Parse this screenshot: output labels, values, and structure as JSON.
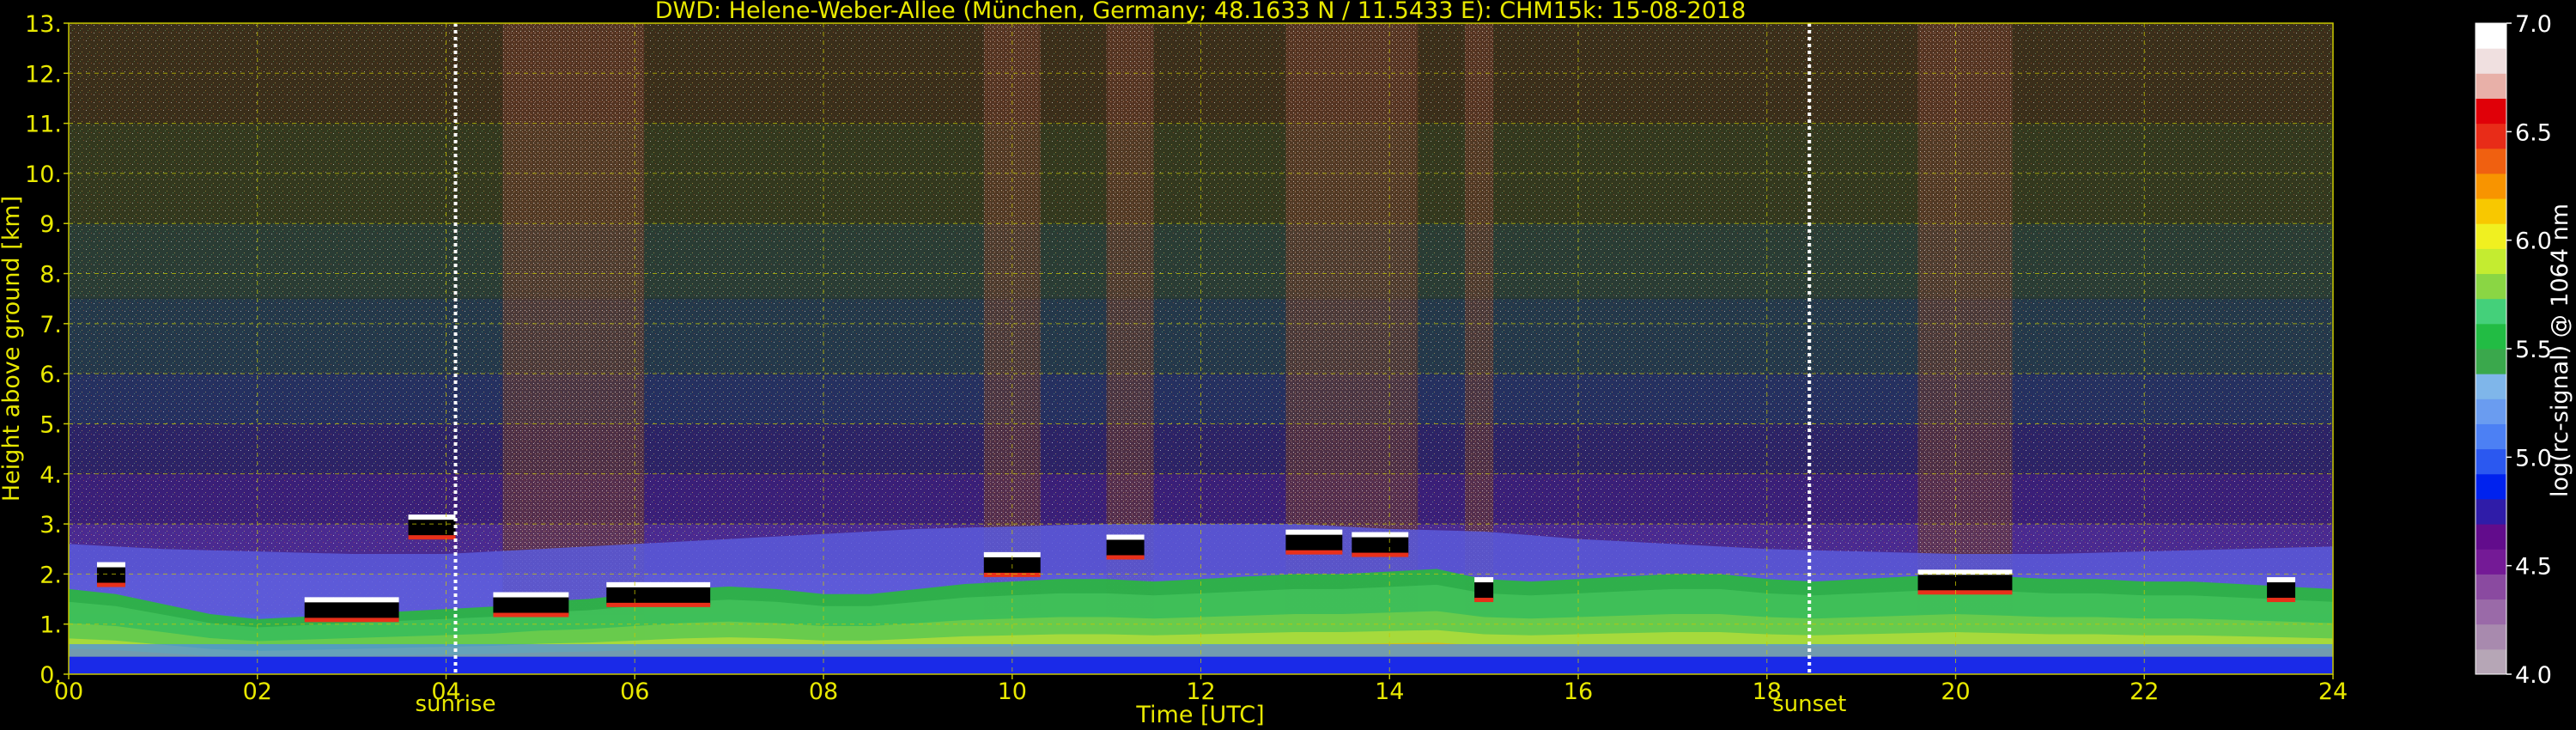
{
  "chart_data": {
    "type": "heatmap",
    "title": "DWD: Helene-Weber-Allee (München, Germany; 48.1633 N / 11.5433 E):    CHM15k: 15-08-2018",
    "xlabel": "Time [UTC]",
    "ylabel": "Height above ground [km]",
    "xlim": [
      0,
      24
    ],
    "ylim": [
      0,
      13
    ],
    "x_ticks": [
      0,
      2,
      4,
      6,
      8,
      10,
      12,
      14,
      16,
      18,
      20,
      22,
      24
    ],
    "x_tick_labels": [
      "00",
      "02",
      "04",
      "06",
      "08",
      "10",
      "12",
      "14",
      "16",
      "18",
      "20",
      "22",
      "24"
    ],
    "y_ticks": [
      0,
      1,
      2,
      3,
      4,
      5,
      6,
      7,
      8,
      9,
      10,
      11,
      12,
      13
    ],
    "y_tick_labels": [
      "0.",
      "1.",
      "2.",
      "3.",
      "4.",
      "5.",
      "6.",
      "7.",
      "8.",
      "9.",
      "10.",
      "11.",
      "12.",
      "13."
    ],
    "grid": true,
    "markers": [
      {
        "label": "sunrise",
        "time": 4.1
      },
      {
        "label": "sunset",
        "time": 18.45
      }
    ],
    "colorbar": {
      "label": "log(rc-signal) @ 1064 nm",
      "range": [
        4.0,
        7.0
      ],
      "ticks": [
        4.0,
        4.5,
        5.0,
        5.5,
        6.0,
        6.5,
        7.0
      ],
      "tick_labels": [
        "4.0",
        "4.5",
        "5.0",
        "5.5",
        "6.0",
        "6.5",
        "7.0"
      ],
      "colors": [
        "#b6a6b6",
        "#a88aae",
        "#9a6aa8",
        "#8a4aa0",
        "#741a96",
        "#620c8c",
        "#2f1ca8",
        "#0022ee",
        "#2b58f0",
        "#4c80f4",
        "#6a9cf0",
        "#7fb6ea",
        "#3aa84c",
        "#22bc44",
        "#44d07a",
        "#8ad644",
        "#c4ec30",
        "#f0f020",
        "#f8c800",
        "#f89400",
        "#f06010",
        "#e82c18",
        "#e00008",
        "#e8b0a8",
        "#f0e0e0",
        "#ffffff"
      ]
    },
    "boundary_layer": {
      "x": [
        0,
        0.5,
        1,
        1.5,
        2,
        2.5,
        3,
        3.5,
        4,
        4.5,
        5,
        5.5,
        6,
        6.5,
        7,
        7.5,
        8,
        8.5,
        9,
        9.5,
        10,
        10.5,
        11,
        11.5,
        12,
        12.5,
        13,
        13.5,
        14,
        14.5,
        15,
        15.5,
        16,
        16.5,
        17,
        17.5,
        18,
        18.5,
        19,
        19.5,
        20,
        20.5,
        21,
        21.5,
        22,
        22.5,
        23,
        23.5,
        24
      ],
      "top_km": [
        1.7,
        1.6,
        1.4,
        1.2,
        1.1,
        1.15,
        1.2,
        1.25,
        1.3,
        1.35,
        1.45,
        1.5,
        1.6,
        1.7,
        1.75,
        1.7,
        1.6,
        1.6,
        1.7,
        1.8,
        1.85,
        1.9,
        1.9,
        1.85,
        1.9,
        1.95,
        2.0,
        2.0,
        2.05,
        2.1,
        1.9,
        1.85,
        1.9,
        1.95,
        2.0,
        2.0,
        1.9,
        1.85,
        1.9,
        1.95,
        2.0,
        1.95,
        1.9,
        1.9,
        1.85,
        1.85,
        1.8,
        1.75,
        1.7
      ]
    },
    "residual_layer": {
      "x": [
        0,
        1,
        2,
        3,
        4,
        5,
        6,
        7,
        8,
        9,
        10,
        11,
        12,
        13,
        14,
        15,
        16,
        17,
        18,
        19,
        20,
        21,
        22,
        23,
        24
      ],
      "top_km": [
        2.6,
        2.5,
        2.45,
        2.4,
        2.4,
        2.5,
        2.6,
        2.7,
        2.8,
        2.9,
        2.95,
        3.0,
        3.0,
        3.0,
        2.9,
        2.85,
        2.7,
        2.6,
        2.5,
        2.45,
        2.4,
        2.4,
        2.45,
        2.5,
        2.55
      ]
    },
    "cloud_segments": [
      {
        "start": 0.3,
        "end": 0.6,
        "height_km": 2.1
      },
      {
        "start": 2.5,
        "end": 3.5,
        "height_km": 1.4
      },
      {
        "start": 3.6,
        "end": 4.1,
        "height_km": 3.05
      },
      {
        "start": 4.5,
        "end": 5.3,
        "height_km": 1.5
      },
      {
        "start": 5.7,
        "end": 6.8,
        "height_km": 1.7
      },
      {
        "start": 9.7,
        "end": 10.3,
        "height_km": 2.3
      },
      {
        "start": 11.0,
        "end": 11.4,
        "height_km": 2.65
      },
      {
        "start": 12.9,
        "end": 13.5,
        "height_km": 2.75
      },
      {
        "start": 13.6,
        "end": 14.2,
        "height_km": 2.7
      },
      {
        "start": 14.9,
        "end": 15.1,
        "height_km": 1.8
      },
      {
        "start": 19.6,
        "end": 20.6,
        "height_km": 1.95
      },
      {
        "start": 23.3,
        "end": 23.6,
        "height_km": 1.8
      }
    ],
    "noise_columns": [
      {
        "start": 4.6,
        "end": 5.6
      },
      {
        "start": 5.6,
        "end": 6.1
      },
      {
        "start": 9.7,
        "end": 10.3
      },
      {
        "start": 11.0,
        "end": 11.5
      },
      {
        "start": 12.9,
        "end": 14.3
      },
      {
        "start": 14.8,
        "end": 15.1
      },
      {
        "start": 19.6,
        "end": 20.6
      }
    ]
  }
}
